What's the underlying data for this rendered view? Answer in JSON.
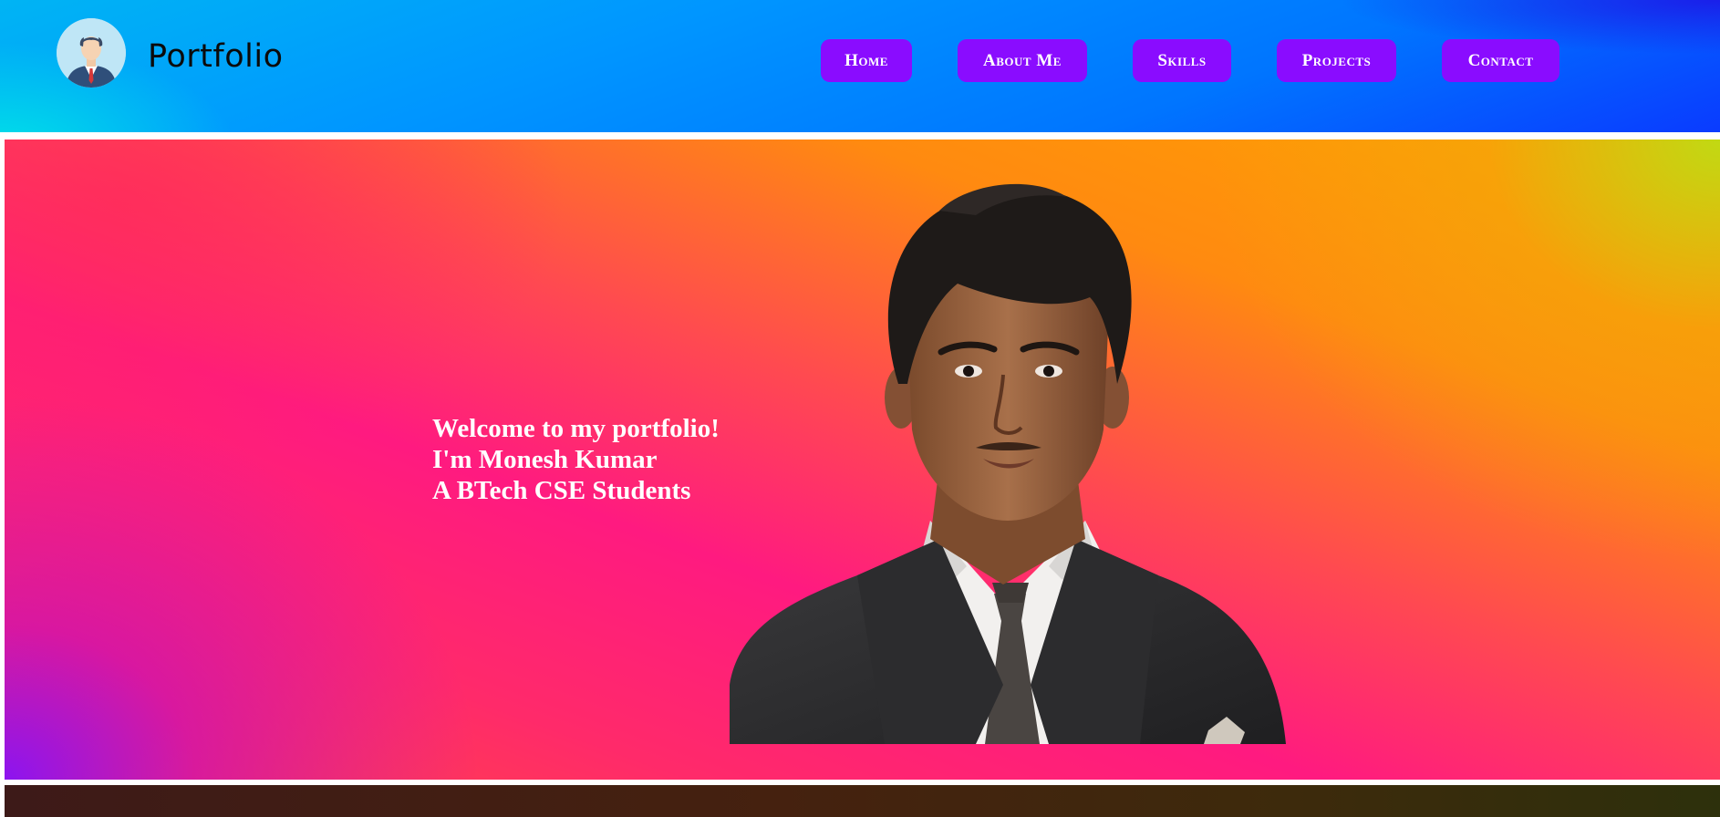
{
  "header": {
    "logo_icon": "businessman-avatar-icon",
    "brand": "Portfolio",
    "nav": {
      "home": "Home",
      "about": "About Me",
      "skills": "Skills",
      "projects": "Projects",
      "contact": "Contact"
    }
  },
  "hero": {
    "line1": "Welcome to my portfolio!",
    "line2": "I'm Monesh Kumar",
    "line3": "A BTech CSE Students",
    "portrait_icon": "profile-portrait-photo"
  },
  "colors": {
    "header_gradient_start": "#00c8f0",
    "header_gradient_end": "#0a3bff",
    "nav_button": "#8a0cff",
    "hero_pink": "#ff1a80",
    "hero_orange": "#ff9a00",
    "hero_purple": "#8c14f0",
    "text_white": "#ffffff"
  }
}
